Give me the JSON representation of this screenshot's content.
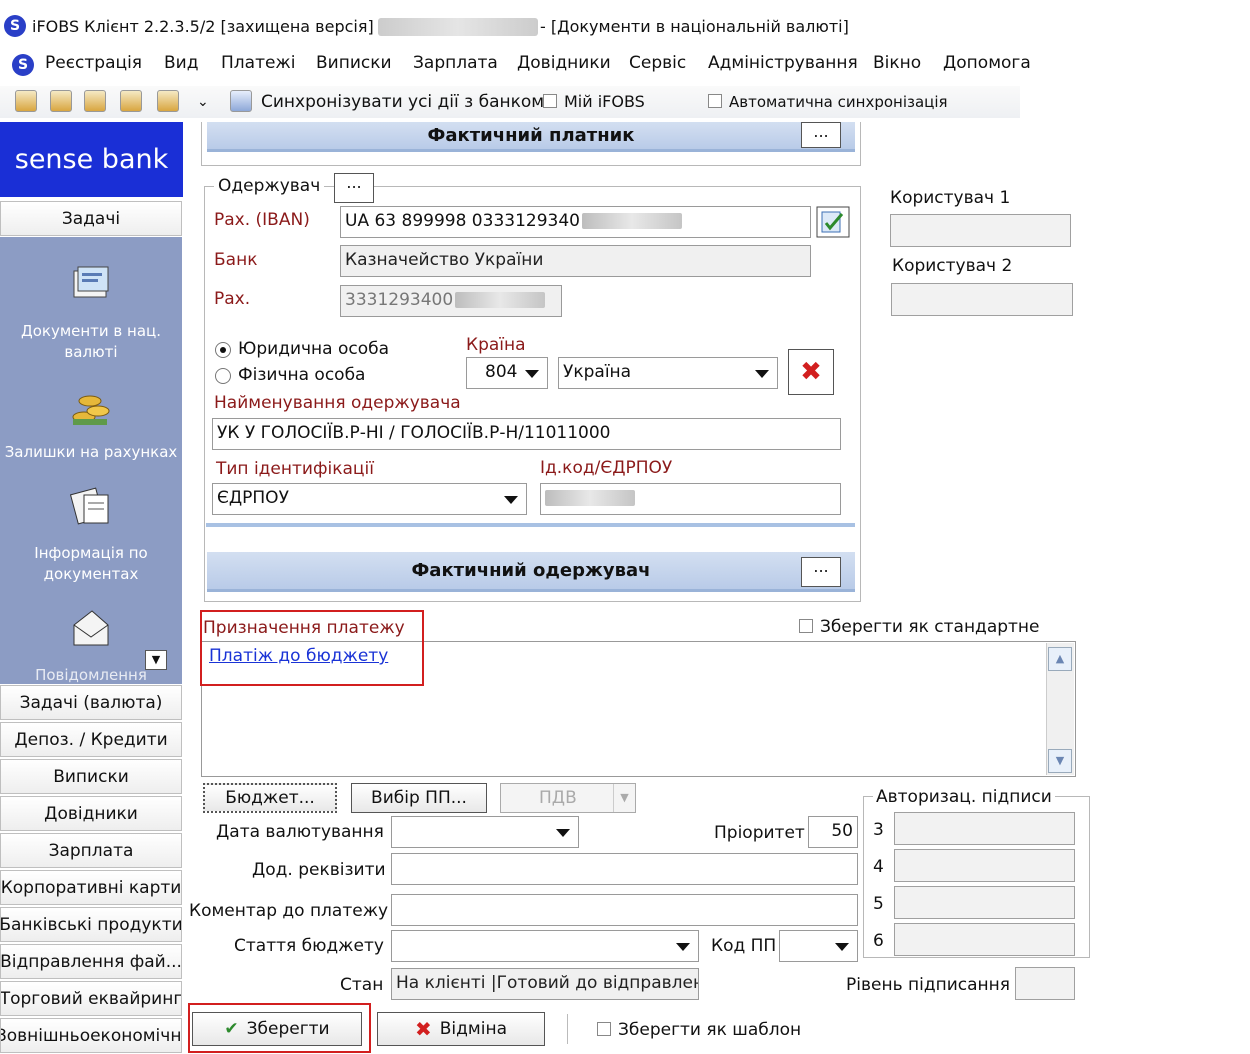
{
  "window": {
    "title_prefix": "iFOBS Клієнт 2.2.3.5/2 [захищена версія] -",
    "title_suffix": "- [Документи в національній валюті]"
  },
  "menu": [
    "Реєстрація",
    "Вид",
    "Платежі",
    "Виписки",
    "Зарплата",
    "Довідники",
    "Сервіс",
    "Адміністрування",
    "Вікно",
    "Допомога"
  ],
  "toolbar": {
    "sync_label": "Синхронізувати усі дії з банком",
    "my_ifobs_label": "Мій iFOBS",
    "auto_sync_label": "Автоматична синхронізація"
  },
  "sidebar": {
    "brand": "sense bank",
    "tasks_label": "Задачі",
    "entries": [
      {
        "label": "Документи в нац. валюті",
        "icon": "documents-icon"
      },
      {
        "label": "Залишки на рахунках",
        "icon": "coins-icon"
      },
      {
        "label": "Інформація по документах",
        "icon": "document-info-icon"
      },
      {
        "label": "Повідомлення",
        "icon": "envelope-icon"
      }
    ],
    "buttons": [
      "Задачі (валюта)",
      "Депоз. / Кредити",
      "Виписки",
      "Довідники",
      "Зарплата",
      "Корпоративні карти",
      "Банківські продукти",
      "Відправлення фай...",
      "Торговий еквайринг",
      "Зовнішньоекономічні"
    ]
  },
  "form": {
    "actual_payer": "Фактичний платник",
    "recipient_group": "Одержувач",
    "dots": "...",
    "iban_label": "Рах. (IBAN)",
    "iban_value": "UA 63 899998 0333129340",
    "bank_label": "Банк",
    "bank_value": "Казначейство України",
    "account_label": "Рах.",
    "account_value": "3331293400",
    "legal_entity": "Юридична особа",
    "individual": "Фізична особа",
    "country_label": "Країна",
    "country_code": "804",
    "country_name": "Україна",
    "recipient_name_label": "Найменування одержувача",
    "recipient_name_value": "УК У ГОЛОСІЇВ.Р-НІ / ГОЛОСІЇВ.Р-Н/11011000",
    "id_type_label": "Тип ідентифікації",
    "id_type_value": "ЄДРПОУ",
    "id_code_label": "Ід.код/ЄДРПОУ",
    "actual_recipient": "Фактичний одержувач",
    "user1_label": "Користувач 1",
    "user2_label": "Користувач 2",
    "purpose_label": "Призначення платежу",
    "save_standard_label": "Зберегти як стандартне",
    "purpose_link": "Платіж до бюджету",
    "budget_btn": "Бюджет...",
    "choose_pp_btn": "Вибір ПП...",
    "vat_label": "ПДВ",
    "auth_signatures_label": "Авторизац. підписи",
    "sig_numbers": [
      "3",
      "4",
      "5",
      "6"
    ],
    "value_date_label": "Дата валютування",
    "priority_label": "Пріоритет",
    "priority_value": "50",
    "extra_details_label": "Дод. реквізити",
    "comment_label": "Коментар до платежу",
    "budget_article_label": "Стаття бюджету",
    "code_pp_label": "Код ПП",
    "status_label": "Стан",
    "status_value": "На клієнті |Готовий до відправлення",
    "sign_level_label": "Рівень підписання",
    "save_btn": "Зберегти",
    "cancel_btn": "Відміна",
    "save_template_label": "Зберегти як шаблон"
  }
}
